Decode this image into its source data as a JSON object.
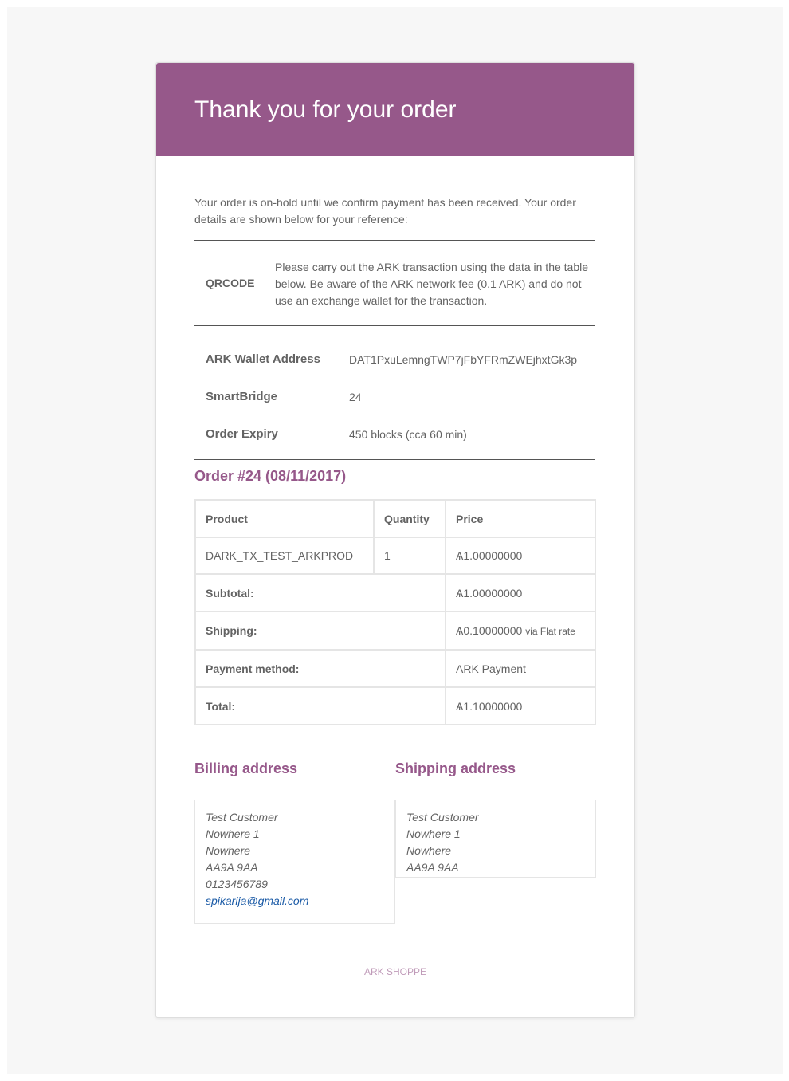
{
  "header": {
    "title": "Thank you for your order"
  },
  "intro": "Your order is on-hold until we confirm payment has been received. Your order details are shown below for your reference:",
  "qr": {
    "label": "QRCODE",
    "text": "Please carry out the ARK transaction using the data in the table below. Be aware of the ARK network fee (0.1 ARK) and do not use an exchange wallet for the transaction."
  },
  "details": [
    {
      "label": "ARK Wallet Address",
      "value": "DAT1PxuLemngTWP7jFbYFRmZWEjhxtGk3p"
    },
    {
      "label": "SmartBridge",
      "value": "24"
    },
    {
      "label": "Order Expiry",
      "value": "450 blocks (cca 60 min)"
    }
  ],
  "order": {
    "title": "Order #24 (08/11/2017)",
    "columns": [
      "Product",
      "Quantity",
      "Price"
    ],
    "item": {
      "product": "DARK_TX_TEST_ARKPROD",
      "quantity": "1",
      "price": "Ѧ1.00000000"
    },
    "totals": [
      {
        "label": "Subtotal:",
        "value": "Ѧ1.00000000",
        "note": ""
      },
      {
        "label": "Shipping:",
        "value": "Ѧ0.10000000",
        "note": "via Flat rate"
      },
      {
        "label": "Payment method:",
        "value": "ARK Payment",
        "note": ""
      },
      {
        "label": "Total:",
        "value": "Ѧ1.10000000",
        "note": ""
      }
    ]
  },
  "billing": {
    "title": "Billing address",
    "lines": [
      "Test Customer",
      "Nowhere 1",
      "Nowhere",
      "AA9A 9AA",
      "0123456789"
    ],
    "email": "spikarija@gmail.com"
  },
  "shipping": {
    "title": "Shipping address",
    "lines": [
      "Test Customer",
      "Nowhere 1",
      "Nowhere",
      "AA9A 9AA"
    ]
  },
  "footer": "ARK SHOPPE",
  "colors": {
    "brand": "#96588a",
    "page_bg": "#f7f7f7",
    "text": "#636363",
    "link": "#1a5aa6"
  }
}
